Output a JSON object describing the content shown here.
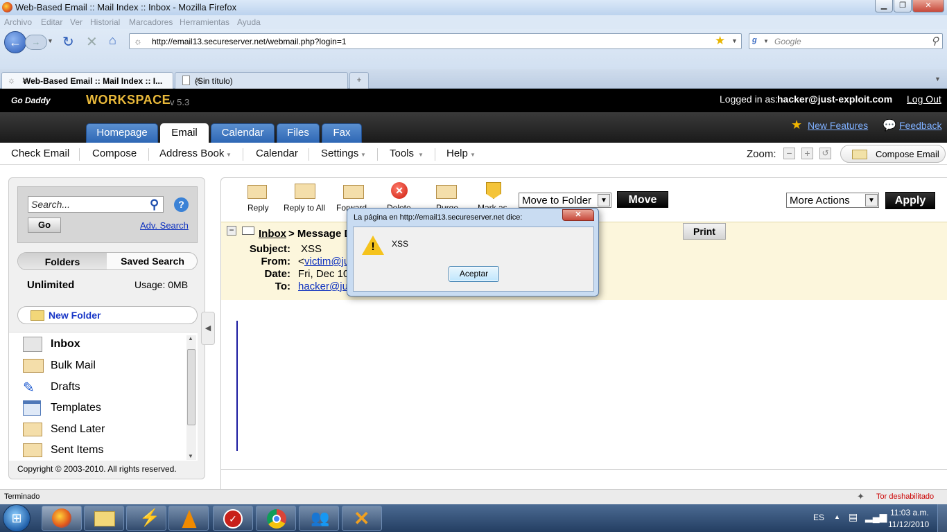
{
  "window": {
    "title": "Web-Based Email :: Mail Index :: Inbox - Mozilla Firefox"
  },
  "menu": [
    "Archivo",
    "Editar",
    "Ver",
    "Historial",
    "Marcadores",
    "Herramientas",
    "Ayuda"
  ],
  "nav": {
    "url": "http://email13.secureserver.net/webmail.php?login=1",
    "search_placeholder": "Google"
  },
  "tabs": [
    {
      "label": "Web-Based Email :: Mail Index :: I..."
    },
    {
      "label": "(Sin título)"
    }
  ],
  "header": {
    "brand": "WORKSPACE",
    "version": "v 5.3",
    "logged_label": "Logged in as:",
    "user": "hacker@just-exploit.com",
    "logout": "Log Out",
    "new_features": "New Features",
    "feedback": "Feedback",
    "godaddy": "Go Daddy"
  },
  "apptabs": [
    "Homepage",
    "Email",
    "Calendar",
    "Files",
    "Fax"
  ],
  "submenu": {
    "check": "Check Email",
    "compose": "Compose",
    "address": "Address Book",
    "calendar": "Calendar",
    "settings": "Settings",
    "tools": "Tools",
    "help": "Help",
    "zoom": "Zoom:",
    "compose_email": "Compose Email"
  },
  "left": {
    "search_placeholder": "Search...",
    "go": "Go",
    "adv": "Adv. Search",
    "tab_folders": "Folders",
    "tab_saved": "Saved Search",
    "quota": "Unlimited",
    "usage": "Usage: 0MB",
    "new_folder": "New Folder",
    "copyright": "Copyright © 2003-2010. All rights reserved.",
    "folders": [
      "Inbox",
      "Bulk Mail",
      "Drafts",
      "Templates",
      "Send Later",
      "Sent Items"
    ]
  },
  "toolbar": {
    "reply": "Reply",
    "reply_all": "Reply to All",
    "forward": "Forward",
    "delete": "Delete",
    "purge": "Purge",
    "mark": "Mark as",
    "move_folder": "Move to Folder",
    "move": "Move",
    "more": "More Actions",
    "apply": "Apply",
    "print": "Print"
  },
  "message": {
    "crumb_inbox": "Inbox",
    "crumb_rest": "> Message D",
    "subject_l": "Subject:",
    "subject": "XSS",
    "from_l": "From:",
    "from_pre": "<",
    "from": "victim@ju",
    "date_l": "Date:",
    "date": "Fri, Dec 10",
    "to_l": "To:",
    "to": "hacker@ju"
  },
  "dialog": {
    "title": "La página en http://email13.secureserver.net dice:",
    "text": "XSS",
    "ok": "Aceptar"
  },
  "status": {
    "text": "Terminado",
    "tor": "Tor deshabilitado"
  },
  "taskbar": {
    "lang": "ES",
    "time": "11:03 a.m.",
    "date": "11/12/2010"
  }
}
